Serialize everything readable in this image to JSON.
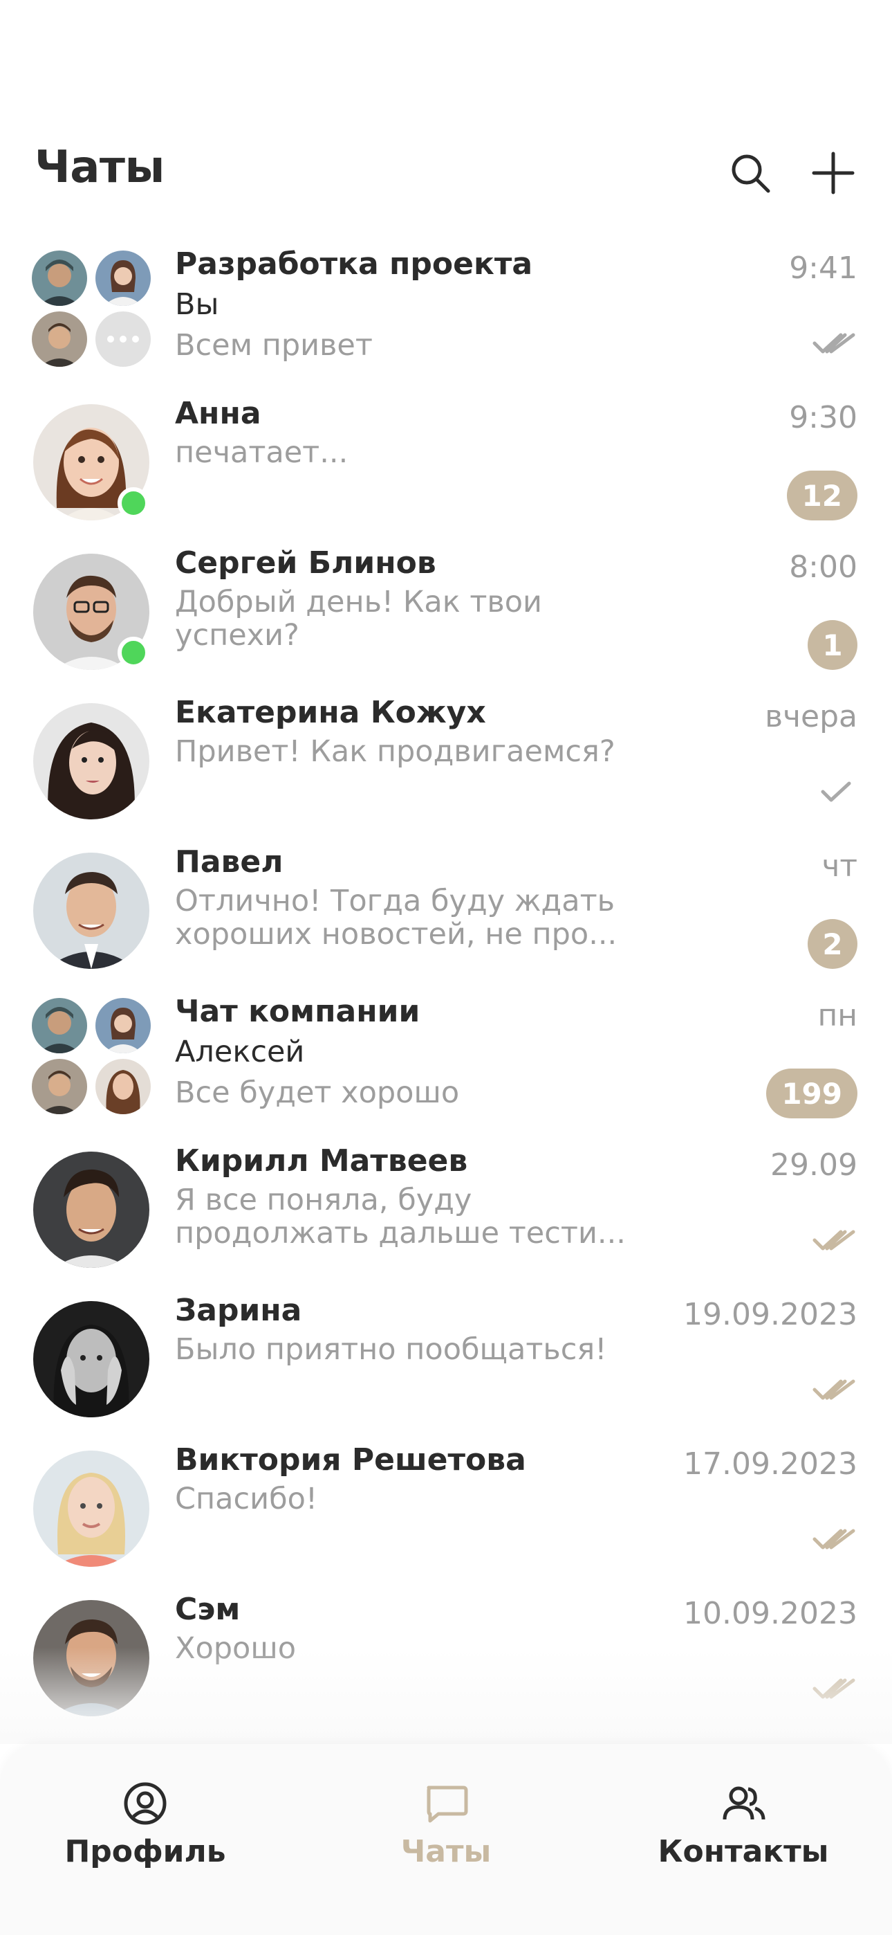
{
  "header": {
    "title": "Чаты",
    "search_icon": "search-icon",
    "add_icon": "plus-icon"
  },
  "colors": {
    "accent": "#c8b9a1",
    "online": "#4fd65a",
    "muted": "#9d9d9d",
    "text": "#2b2b2b"
  },
  "chats": [
    {
      "name": "Разработка проекта",
      "sender": "Вы",
      "message": "Всем привет",
      "time": "9:41",
      "status": "read-grey"
    },
    {
      "name": "Анна",
      "message": "печатает...",
      "time": "9:30",
      "unread": "12",
      "online": true
    },
    {
      "name": "Сергей Блинов",
      "message": "Добрый день! Как твои успехи?",
      "time": "8:00",
      "unread": "1",
      "online": true
    },
    {
      "name": "Екатерина Кожух",
      "message": "Привет! Как продвигаемся?",
      "time": "вчера",
      "status": "sent"
    },
    {
      "name": "Павел",
      "message": "Отлично! Тогда буду ждать хороших новостей, не про...",
      "time": "чт",
      "unread": "2"
    },
    {
      "name": "Чат компании",
      "sender": "Алексей",
      "message": "Все будет хорошо",
      "time": "пн",
      "unread": "199"
    },
    {
      "name": "Кирилл Матвеев",
      "message": "Я все поняла, буду продолжать дальше тести...",
      "time": "29.09",
      "status": "read"
    },
    {
      "name": "Зарина",
      "message": "Было приятно пообщаться!",
      "time": "19.09.2023",
      "status": "read"
    },
    {
      "name": "Виктория Решетова",
      "message": "Спасибо!",
      "time": "17.09.2023",
      "status": "read"
    },
    {
      "name": "Сэм",
      "message": "Хорошо",
      "time": "10.09.2023",
      "status": "read"
    }
  ],
  "tabs": [
    {
      "label": "Профиль",
      "icon": "profile-icon"
    },
    {
      "label": "Чаты",
      "icon": "chat-bubble-icon",
      "active": true
    },
    {
      "label": "Контакты",
      "icon": "contacts-icon"
    }
  ]
}
